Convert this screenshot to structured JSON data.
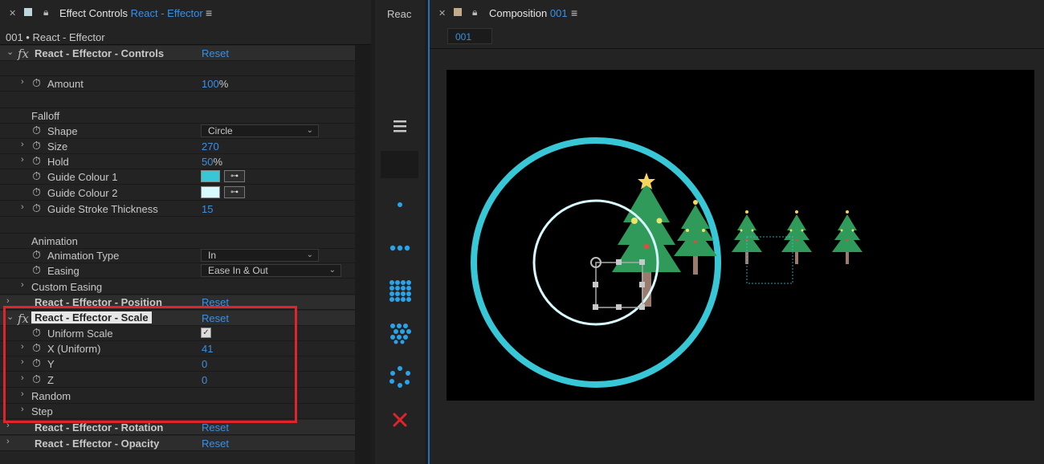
{
  "effect_controls": {
    "tab_label": "Effect Controls",
    "tab_target": "React - Effector",
    "breadcrumb": "001 • React - Effector",
    "controls_group": {
      "title": "React - Effector - Controls",
      "reset": "Reset",
      "amount_label": "Amount",
      "amount_value": "100",
      "amount_unit": "%",
      "falloff_label": "Falloff",
      "shape_label": "Shape",
      "shape_value": "Circle",
      "size_label": "Size",
      "size_value": "270",
      "hold_label": "Hold",
      "hold_value": "50",
      "hold_unit": "%",
      "guide_colour_1_label": "Guide Colour 1",
      "guide_colour_1": "#38c7d6",
      "guide_colour_2_label": "Guide Colour 2",
      "guide_colour_2": "#d8fbff",
      "guide_stroke_label": "Guide Stroke Thickness",
      "guide_stroke_value": "15",
      "animation_label": "Animation",
      "animation_type_label": "Animation Type",
      "animation_type_value": "In",
      "easing_label": "Easing",
      "easing_value": "Ease In & Out",
      "custom_easing_label": "Custom Easing"
    },
    "position_group": {
      "title": "React - Effector - Position",
      "reset": "Reset"
    },
    "scale_group": {
      "title": "React - Effector - Scale",
      "reset": "Reset",
      "uniform_label": "Uniform Scale",
      "uniform_checked": true,
      "x_label": "X (Uniform)",
      "x_value": "41",
      "y_label": "Y",
      "y_value": "0",
      "z_label": "Z",
      "z_value": "0",
      "random_label": "Random",
      "step_label": "Step"
    },
    "rotation_group": {
      "title": "React - Effector - Rotation",
      "reset": "Reset"
    },
    "opacity_group": {
      "title": "React - Effector - Opacity",
      "reset": "Reset"
    }
  },
  "middle_panel": {
    "tab_label": "Reac",
    "icons": [
      "hamburger-menu-icon",
      "single-dot-icon",
      "three-dots-icon",
      "dot-grid-icon",
      "dot-grid-offset-icon",
      "dot-ring-icon",
      "close-icon"
    ],
    "accent": "#29a4ea",
    "close_color": "#e0242b"
  },
  "composition": {
    "tab_label": "Composition",
    "tab_name": "001",
    "chip": "001",
    "outer_ring_color": "#38c7d6",
    "inner_ring_color": "#d8fbff"
  },
  "highlight_color": "#e0242b"
}
